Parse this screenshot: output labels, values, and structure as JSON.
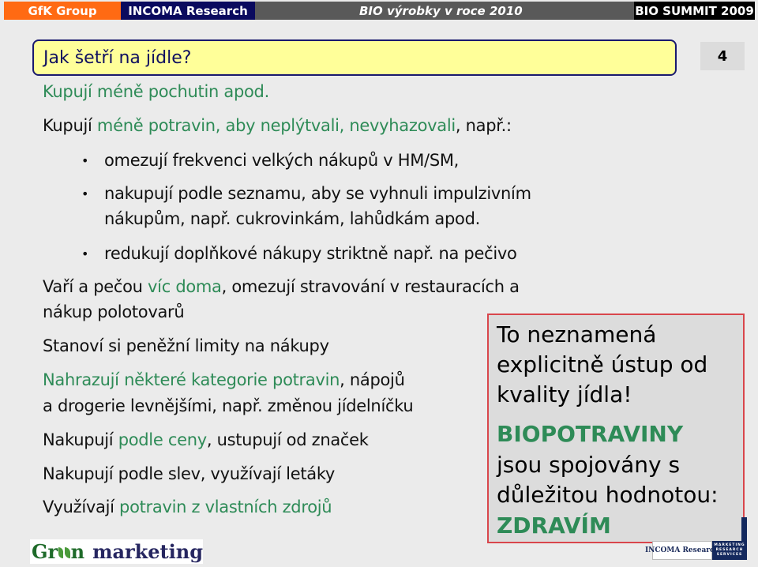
{
  "header": {
    "gfk": "GfK Group",
    "incoma": "INCOMA  Research",
    "event_title": "BIO výrobky v roce 2010",
    "summit": "BIO SUMMIT 2009"
  },
  "slide": {
    "title": "Jak šetří na jídle?",
    "page_number": "4"
  },
  "content": {
    "line1": "Kupují méně pochutin apod.",
    "line2": {
      "a": "Kupují ",
      "b": "méně potravin, aby neplýtvali, nevyhazovali",
      "c": ", např.:"
    },
    "bullets": [
      {
        "lines": [
          "omezují frekvenci velkých nákupů v HM/SM,"
        ]
      },
      {
        "lines": [
          "nakupují podle seznamu, aby se vyhnuli impulzivním",
          "nákupům, např. cukrovinkám, lahůdkám apod."
        ]
      },
      {
        "lines": [
          "redukují doplňkové nákupy striktně např. na pečivo"
        ]
      }
    ],
    "line3": {
      "a": "Vaří a pečou ",
      "b": "víc doma",
      "c": ", omezují stravování v restauracích a",
      "d": "nákup polotovarů"
    },
    "line4": "Stanoví si peněžní limity na nákupy",
    "line5": {
      "a": "Nahrazují některé kategorie potravin",
      "b": ", nápojů",
      "c": "a drogerie levnějšími, např. změnou jídelníčku"
    },
    "line6": {
      "a": "Nakupují ",
      "b": "podle ceny",
      "c": ", ustupují od značek"
    },
    "line7": "Nakupují podle slev, využívají letáky",
    "line8": {
      "a": "Využívají ",
      "b": "potravin z vlastních zdrojů"
    }
  },
  "callout": {
    "line1": "To neznamená",
    "line2": "explicitně ústup od",
    "line3": "kvality jídla!",
    "emph1": "BIOPOTRAVINY",
    "line4": "jsou spojovány s",
    "line5": "důležitou hodnotou:",
    "emph2": "ZDRAVÍM"
  },
  "footer": {
    "green_logo_a": "Gr",
    "green_logo_b": "n",
    "green_logo_c": "marketing",
    "incoma_logo": "INCOMA Research",
    "incoma_tag": [
      "MARKETING",
      "RESEARCH",
      "SERVICES"
    ]
  },
  "colors": {
    "accent_green": "#2e8b57",
    "title_box_bg": "#ffff99",
    "callout_border": "#d9464c",
    "gfk_orange": "#ff6a13",
    "incoma_navy": "#0a0a5e"
  }
}
